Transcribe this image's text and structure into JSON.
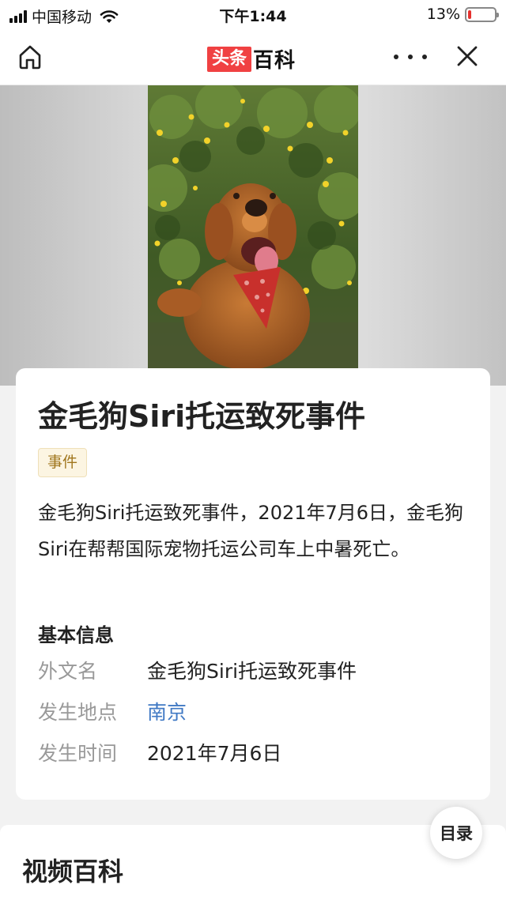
{
  "status_bar": {
    "carrier": "中国移动",
    "time": "下午1:44",
    "battery_text": "13%",
    "battery_level": 0.13,
    "battery_color": "#e5312e"
  },
  "nav": {
    "brand_red": "头条",
    "brand_black": "百科",
    "home_icon": "home-icon",
    "more_icon": "more-dots-icon",
    "close_icon": "close-icon"
  },
  "hero": {
    "image_subject": "golden-retriever-photo"
  },
  "article": {
    "title": "金毛狗Siri托运致死事件",
    "tag": "事件",
    "summary": "金毛狗Siri托运致死事件，2021年7月6日，金毛狗Siri在帮帮国际宠物托运公司车上中暑死亡。"
  },
  "basic_info": {
    "title": "基本信息",
    "rows": [
      {
        "label": "外文名",
        "value": "金毛狗Siri托运致死事件"
      },
      {
        "label": "发生地点",
        "value": "南京"
      },
      {
        "label": "发生时间",
        "value": "2021年7月6日"
      }
    ]
  },
  "video_section": {
    "title": "视频百科"
  },
  "toc_button": {
    "label": "目录"
  },
  "colors": {
    "brand_red": "#f04142",
    "link_blue": "#4079c4",
    "tag_text": "#a0761d",
    "tag_bg": "#fcf5e2"
  }
}
